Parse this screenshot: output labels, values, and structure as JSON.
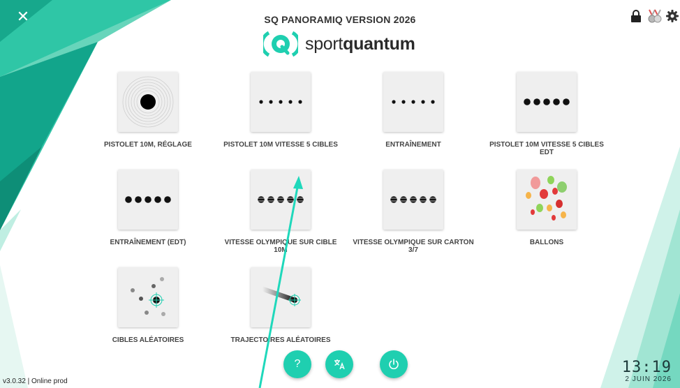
{
  "header": {
    "title": "SQ PANORAMIQ VERSION 2026",
    "close_icon": "close-icon",
    "icons": [
      "lock-icon",
      "medals-icon",
      "gear-icon"
    ]
  },
  "logo": {
    "word_prefix": "sport",
    "word_bold": "quantum"
  },
  "tiles": [
    {
      "label": "PISTOLET 10M, RÉGLAGE",
      "icon": "target-icon"
    },
    {
      "label": "PISTOLET 10M VITESSE 5 CIBLES",
      "icon": "five-small-dots-icon"
    },
    {
      "label": "ENTRAÎNEMENT",
      "icon": "five-small-dots-icon"
    },
    {
      "label": "PISTOLET 10M VITESSE 5 CIBLES EDT",
      "icon": "five-dots-icon"
    },
    {
      "label": "ENTRAÎNEMENT (EDT)",
      "icon": "five-dots-icon"
    },
    {
      "label": "VITESSE OLYMPIQUE SUR CIBLE 10M",
      "icon": "five-striped-dots-icon"
    },
    {
      "label": "VITESSE OLYMPIQUE SUR CARTON 3/7",
      "icon": "five-striped-dots-icon"
    },
    {
      "label": "BALLONS",
      "icon": "balloons-icon"
    },
    {
      "label": "CIBLES ALÉATOIRES",
      "icon": "random-targets-icon"
    },
    {
      "label": "TRAJECTOIRES ALÉATOIRES",
      "icon": "trajectory-icon"
    }
  ],
  "bottom_buttons": [
    {
      "icon": "help-icon",
      "glyph": "?"
    },
    {
      "icon": "translate-icon",
      "glyph": ""
    },
    {
      "icon": "power-icon",
      "glyph": ""
    }
  ],
  "footer": {
    "version": "v3.0.32 | Online prod",
    "time": "13:19",
    "date": "2 JUIN 2026"
  },
  "colors": {
    "accent": "#1fcfb0",
    "teal_dark": "#0f8f7a",
    "teal_light": "#a8e6d8"
  }
}
